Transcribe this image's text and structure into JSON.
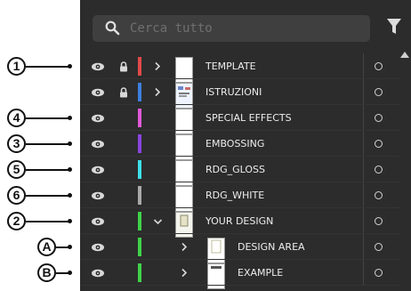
{
  "search": {
    "placeholder": "Cerca tutto"
  },
  "colors": {
    "panel_bg": "#2c2c2c",
    "search_bg": "#3f3f3f",
    "text": "#ededed",
    "red": "#e24a4a",
    "blue": "#3d7fe0",
    "magenta": "#e05ad8",
    "purple": "#8a44e0",
    "cyan": "#3fe0ea",
    "gray": "#a9a9a9",
    "green": "#3fd24a"
  },
  "annotations": [
    {
      "label": "1",
      "row": 0
    },
    {
      "label": "4",
      "row": 2
    },
    {
      "label": "3",
      "row": 3
    },
    {
      "label": "5",
      "row": 4
    },
    {
      "label": "6",
      "row": 5
    },
    {
      "label": "2",
      "row": 6
    },
    {
      "label": "A",
      "row": 7
    },
    {
      "label": "B",
      "row": 8
    }
  ],
  "layers": [
    {
      "name": "TEMPLATE",
      "color": "#e24a4a",
      "locked": true,
      "expander": "right",
      "indent": 0,
      "thumb": "blank"
    },
    {
      "name": "ISTRUZIONI",
      "color": "#3d7fe0",
      "locked": true,
      "expander": "right",
      "indent": 0,
      "thumb": "instructions"
    },
    {
      "name": "SPECIAL EFFECTS",
      "color": "#e05ad8",
      "locked": false,
      "expander": "none",
      "indent": 0,
      "thumb": "blank"
    },
    {
      "name": "EMBOSSING",
      "color": "#8a44e0",
      "locked": false,
      "expander": "none",
      "indent": 0,
      "thumb": "blank"
    },
    {
      "name": "RDG_GLOSS",
      "color": "#3fe0ea",
      "locked": false,
      "expander": "none",
      "indent": 0,
      "thumb": "blank"
    },
    {
      "name": "RDG_WHITE",
      "color": "#a9a9a9",
      "locked": false,
      "expander": "none",
      "indent": 0,
      "thumb": "blank"
    },
    {
      "name": "YOUR DESIGN",
      "color": "#3fd24a",
      "locked": false,
      "expander": "down",
      "indent": 0,
      "thumb": "design"
    },
    {
      "name": "DESIGN AREA",
      "color": "#3fd24a",
      "locked": false,
      "expander": "right",
      "indent": 1,
      "thumb": "area"
    },
    {
      "name": "EXAMPLE",
      "color": "#3fd24a",
      "locked": false,
      "expander": "right",
      "indent": 1,
      "thumb": "example"
    }
  ]
}
